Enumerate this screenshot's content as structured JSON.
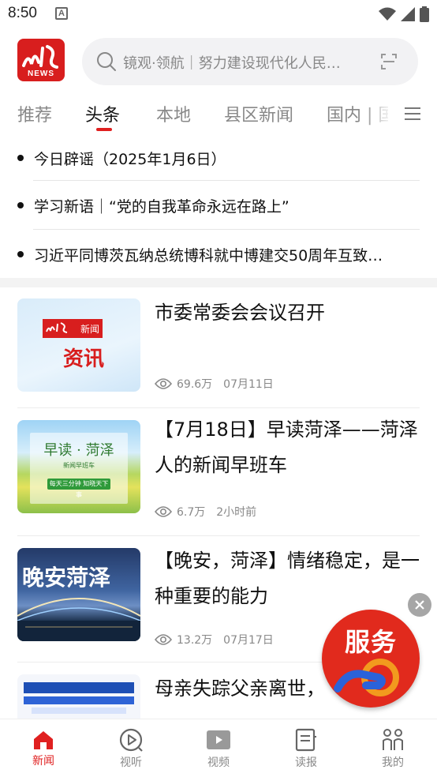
{
  "status_bar": {
    "time": "8:50",
    "notification_glyph": "A"
  },
  "header": {
    "logo_text": "NEWS",
    "search_placeholder": "镜观·领航｜努力建设现代化人民…",
    "brand_color": "#d81e1e"
  },
  "tabs": [
    {
      "label": "推荐"
    },
    {
      "label": "头条"
    },
    {
      "label": "本地"
    },
    {
      "label": "县区新闻"
    },
    {
      "label": "国内 | 国"
    }
  ],
  "active_tab": "头条",
  "headlines": [
    {
      "text": "今日辟谣（2025年1月6日）"
    },
    {
      "text": "学习新语｜“党的自我革命永远在路上”"
    },
    {
      "text": "习近平同博茨瓦纳总统博科就中博建交50周年互致…"
    }
  ],
  "articles": [
    {
      "title": "市委常委会会议召开",
      "views": "69.6万",
      "date": "07月11日",
      "thumb_tag": "新闻",
      "thumb_text": "资讯"
    },
    {
      "title": "【7月18日】早读菏泽——菏泽人的新闻早班车",
      "views": "6.7万",
      "date": "2小时前",
      "thumb_title": "早读 · 菏泽",
      "thumb_subtitle": "新闻早班车",
      "thumb_caption": "每天三分钟 知晓天下事"
    },
    {
      "title": "【晚安，菏泽】情绪稳定，是一种重要的能力",
      "views": "13.2万",
      "date": "07月17日",
      "thumb_text": "晚安菏泽"
    },
    {
      "title": "母亲失踪父亲离世，"
    }
  ],
  "service_badge": {
    "label": "服务"
  },
  "bottom_nav": [
    {
      "label": "新闻",
      "icon": "home-icon",
      "active": true
    },
    {
      "label": "视听",
      "icon": "play-icon",
      "active": false
    },
    {
      "label": "视频",
      "icon": "video-icon",
      "active": false
    },
    {
      "label": "读报",
      "icon": "newspaper-icon",
      "active": false
    },
    {
      "label": "我的",
      "icon": "profile-icon",
      "active": false
    }
  ],
  "colors": {
    "accent": "#e02020",
    "muted": "#888888"
  }
}
